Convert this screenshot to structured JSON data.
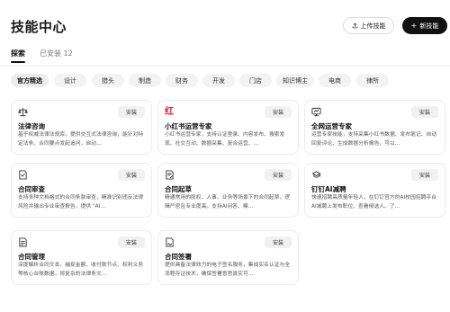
{
  "header": {
    "title": "技能中心",
    "upload_label": "上传技能",
    "new_label": "新技能"
  },
  "tabs": {
    "explore": "探索",
    "installed": "已安装 12"
  },
  "categories": [
    "官方精选",
    "设计",
    "猎头",
    "制造",
    "财务",
    "开发",
    "门店",
    "知识博主",
    "电商",
    "律所"
  ],
  "cards": [
    {
      "icon": "scale-icon",
      "name": "法律咨询",
      "desc": "基于权威法律法规库，提供交互式法律咨询，能针对特定法条、合同要点发起追问，自动…",
      "install": "安装"
    },
    {
      "icon": "xiaohongshu-logo",
      "name": "小红书运营专家",
      "desc": "小红书运营专家，支持认证登录、内容发布、搜索发现、社交互动、数据采集、复合运营、…",
      "install": "安装"
    },
    {
      "icon": "monitor-icon",
      "name": "全网运营专家",
      "desc": "运营专家技能，支持采集小红书数据、发布笔记、自动回复评论、生成数据分析报告，可以…",
      "install": "安装"
    },
    {
      "icon": "contract-check-icon",
      "name": "合同审查",
      "desc": "支持多种文档格式的合同条款审查，精准识别违反法律风险并输出专业审查报告，提供 \"AI…",
      "install": "安装"
    },
    {
      "icon": "contract-draft-icon",
      "name": "合同起草",
      "desc": "精通常用的股权、人事、业务等场景下的合同起草，逻辑严密且专业度高。支持AI问答、模…",
      "install": "安装"
    },
    {
      "icon": "recruit-icon",
      "name": "钉钉AI减聘",
      "desc": "快速招聘高质量年轻人，在钉钉官方的AI校园招聘平台AI减聘上发布职位、查看候选人、了…",
      "install": "安装"
    },
    {
      "icon": "contract-manage-icon",
      "name": "合同管理",
      "desc": "深度解析合同文本，捕捉金额、收付款节点、权利义务等核心台账数据，将复杂的法律条文…",
      "install": "安装"
    },
    {
      "icon": "sign-icon",
      "name": "合同签署",
      "desc": "提供具备法律效力的电子签名服务，集成实名认证与全流程存证技术，确保签署意思真实可…",
      "install": "安装"
    }
  ],
  "colors": {
    "accent_dark": "#111111",
    "xiaohongshu_red": "#e0202a"
  }
}
